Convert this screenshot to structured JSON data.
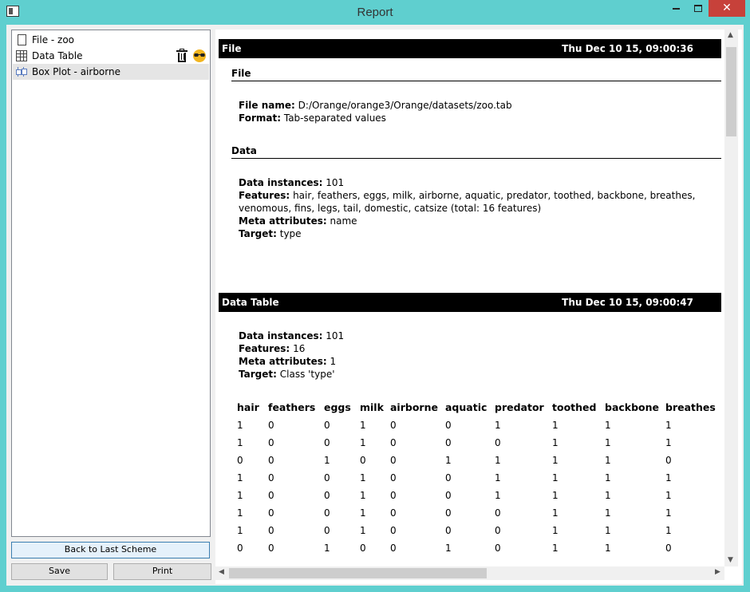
{
  "window": {
    "title": "Report"
  },
  "sidebar": {
    "items": [
      {
        "label": "File - zoo",
        "icon": "file-icon"
      },
      {
        "label": "Data Table",
        "icon": "table-icon"
      },
      {
        "label": "Box Plot - airborne",
        "icon": "boxplot-icon"
      }
    ],
    "back_button": "Back to Last Scheme",
    "save_button": "Save",
    "print_button": "Print"
  },
  "report": {
    "file_section": {
      "title": "File",
      "timestamp": "Thu Dec 10 15, 09:00:36",
      "file_sub": "File",
      "file_name_label": "File name:",
      "file_name": "D:/Orange/orange3/Orange/datasets/zoo.tab",
      "format_label": "Format:",
      "format": "Tab-separated values",
      "data_sub": "Data",
      "instances_label": "Data instances:",
      "instances": "101",
      "features_label": "Features:",
      "features_line1": "hair, feathers, eggs, milk, airborne, aquatic, predator, toothed, backbone, breathes,",
      "features_line2": "venomous, fins, legs, tail, domestic, catsize (total: 16 features)",
      "meta_label": "Meta attributes:",
      "meta": "name",
      "target_label": "Target:",
      "target": "type"
    },
    "table_section": {
      "title": "Data Table",
      "timestamp": "Thu Dec 10 15, 09:00:47",
      "instances_label": "Data instances:",
      "instances": "101",
      "features_label": "Features:",
      "features": "16",
      "meta_label": "Meta attributes:",
      "meta": "1",
      "target_label": "Target:",
      "target": "Class 'type'",
      "columns": [
        "hair",
        "feathers",
        "eggs",
        "milk",
        "airborne",
        "aquatic",
        "predator",
        "toothed",
        "backbone",
        "breathes"
      ],
      "rows": [
        [
          "1",
          "0",
          "0",
          "1",
          "0",
          "0",
          "1",
          "1",
          "1",
          "1"
        ],
        [
          "1",
          "0",
          "0",
          "1",
          "0",
          "0",
          "0",
          "1",
          "1",
          "1"
        ],
        [
          "0",
          "0",
          "1",
          "0",
          "0",
          "1",
          "1",
          "1",
          "1",
          "0"
        ],
        [
          "1",
          "0",
          "0",
          "1",
          "0",
          "0",
          "1",
          "1",
          "1",
          "1"
        ],
        [
          "1",
          "0",
          "0",
          "1",
          "0",
          "0",
          "1",
          "1",
          "1",
          "1"
        ],
        [
          "1",
          "0",
          "0",
          "1",
          "0",
          "0",
          "0",
          "1",
          "1",
          "1"
        ],
        [
          "1",
          "0",
          "0",
          "1",
          "0",
          "0",
          "0",
          "1",
          "1",
          "1"
        ],
        [
          "0",
          "0",
          "1",
          "0",
          "0",
          "1",
          "0",
          "1",
          "1",
          "0"
        ]
      ]
    }
  }
}
